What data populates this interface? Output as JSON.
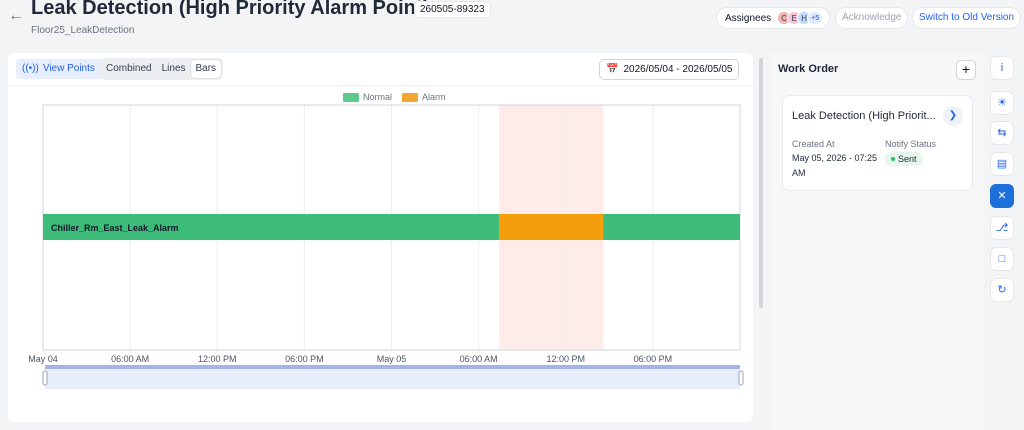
{
  "header": {
    "title": "Leak Detection (High Priority Alarm Point)",
    "id_badge": "260505-89323",
    "subtitle": "Floor25_LeakDetection",
    "assignees_label": "Assignees",
    "avatars": [
      "C",
      "E",
      "H"
    ],
    "avatars_more": "+5",
    "acknowledge_label": "Acknowledge",
    "switch_label": "Switch to Old Version"
  },
  "toolbar": {
    "view_points_label": "View Points",
    "modes": [
      "Combined",
      "Lines",
      "Bars"
    ],
    "active_mode": "Bars",
    "date_range": "2026/05/04 - 2026/05/05"
  },
  "legend": [
    {
      "label": "Normal",
      "color": "#3dbb78"
    },
    {
      "label": "Alarm",
      "color": "#f59e0b"
    }
  ],
  "chart_data": {
    "type": "bar",
    "orientation": "horizontal-timeline",
    "x_ticks": [
      "May 04",
      "06:00 AM",
      "12:00 PM",
      "06:00 PM",
      "May 05",
      "06:00 AM",
      "12:00 PM",
      "06:00 PM"
    ],
    "x_range_hours": [
      0,
      48
    ],
    "categories": [
      "Chiller_Rm_East_Leak_Alarm"
    ],
    "segments": [
      {
        "state": "Normal",
        "start_hour": 0,
        "end_hour": 31.4
      },
      {
        "state": "Alarm",
        "start_hour": 31.4,
        "end_hour": 38.6
      },
      {
        "state": "Normal",
        "start_hour": 38.6,
        "end_hour": 48
      }
    ],
    "highlight_range_hours": [
      31.4,
      38.6
    ],
    "grid": true,
    "legend_position": "top-center"
  },
  "work_order": {
    "title": "Work Order",
    "card_title": "Leak Detection (High Priorit...",
    "created_label": "Created At",
    "created_value": "May 05, 2026 - 07:25 AM",
    "notify_label": "Notify Status",
    "notify_value": "Sent"
  },
  "rail_icons": [
    "info-icon",
    "lightbulb-icon",
    "sliders-icon",
    "inbox-icon",
    "tools-icon",
    "flow-icon",
    "chat-icon",
    "refresh-icon"
  ],
  "colors": {
    "accent": "#2563eb",
    "normal": "#3dbb78",
    "alarm": "#f59e0b",
    "highlight": "#fdecea"
  }
}
